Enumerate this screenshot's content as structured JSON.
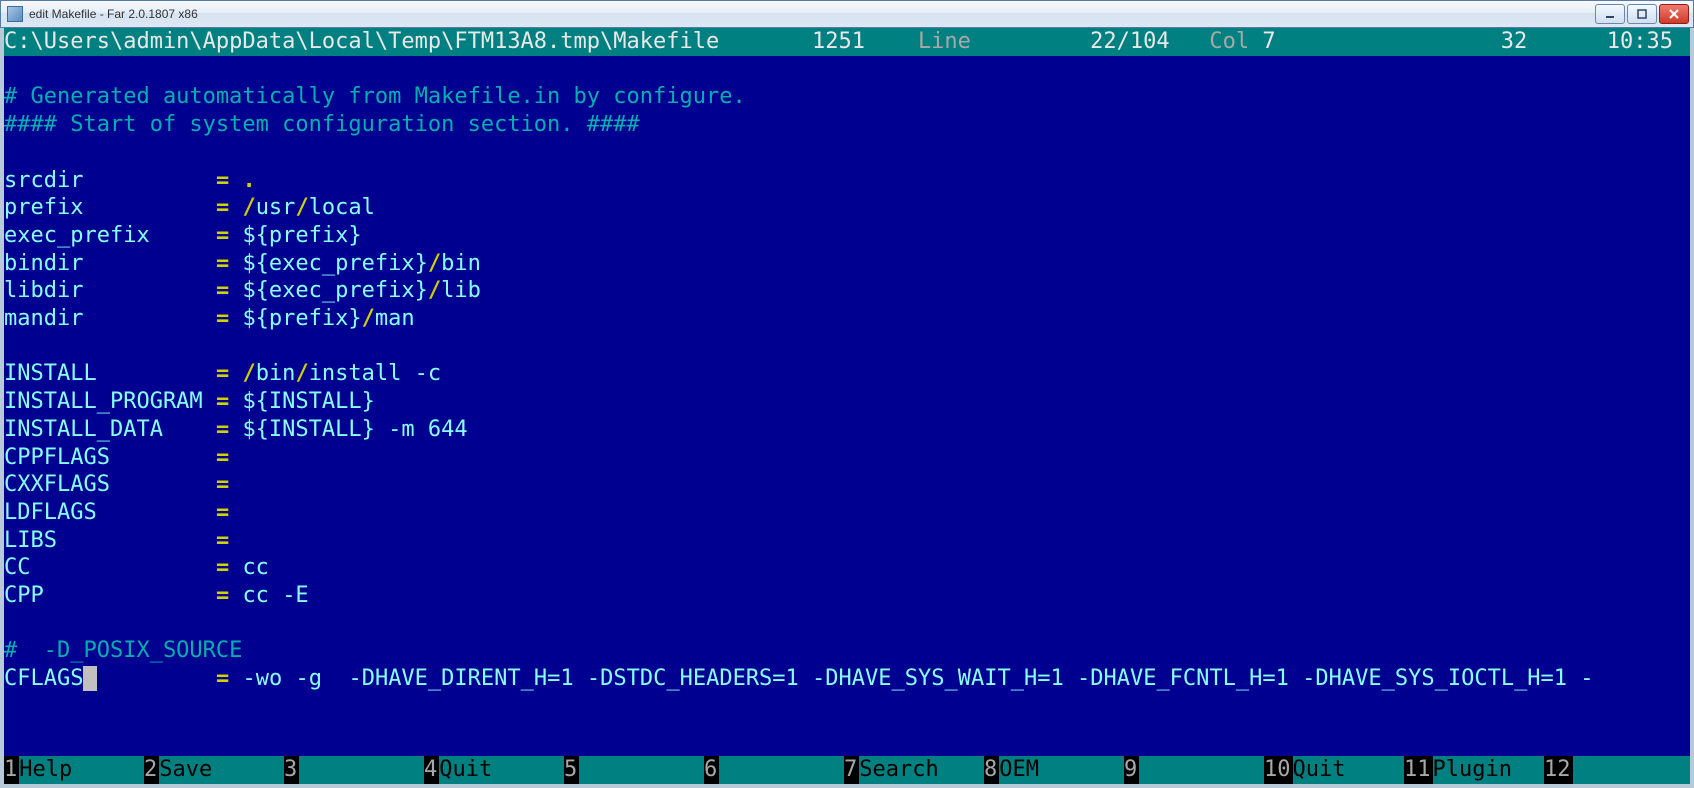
{
  "window": {
    "title": "edit Makefile - Far 2.0.1807 x86"
  },
  "status": {
    "path": "C:\\Users\\admin\\AppData\\Local\\Temp\\FTM13A8.tmp\\Makefile",
    "codepage": "1251",
    "line_label": "Line",
    "line_pos": "22/104",
    "col_label": "Col",
    "col_val": "7",
    "charcode": "32",
    "time": "10:35"
  },
  "content": {
    "l1": "# Generated automatically from Makefile.in by configure.",
    "l2": "#### Start of system configuration section. ####",
    "srcdir": "srcdir",
    "prefix": "prefix",
    "exec_prefix": "exec_prefix",
    "bindir": "bindir",
    "libdir": "libdir",
    "mandir": "mandir",
    "install": "INSTALL",
    "install_program": "INSTALL_PROGRAM",
    "install_data": "INSTALL_DATA",
    "cppflags": "CPPFLAGS",
    "cxxflags": "CXXFLAGS",
    "ldflags": "LDFLAGS",
    "libs": "LIBS",
    "cc": "CC",
    "cpp": "CPP",
    "posix_comment": "#  -D_POSIX_SOURCE",
    "cflags": "CFLAGS",
    "eq": "=",
    "dot": ".",
    "usr": "usr",
    "local": "local",
    "bin": "bin",
    "lib": "lib",
    "man": "man",
    "install_word": "install",
    "cc_word": "cc",
    "dash_c": "-c",
    "dash_E": "-E",
    "m644": "-m 644",
    "dollar_prefix": "${prefix}",
    "dollar_exec_prefix": "${exec_prefix}",
    "dollar_install": "${INSTALL}",
    "slash": "/",
    "wo": "-wo",
    "g": "-g",
    "f1": "-DHAVE_DIRENT_H=1",
    "f2": "-DSTDC_HEADERS=1",
    "f3": "-DHAVE_SYS_WAIT_H=1",
    "f4": "-DHAVE_FCNTL_H=1",
    "f5": "-DHAVE_SYS_IOCTL_H=1",
    "dash": "-"
  },
  "keybar": [
    {
      "n": "1",
      "label": "Help  "
    },
    {
      "n": "2",
      "label": "Save  "
    },
    {
      "n": "3",
      "label": "      "
    },
    {
      "n": "4",
      "label": "Quit  "
    },
    {
      "n": "5",
      "label": "      "
    },
    {
      "n": "6",
      "label": "      "
    },
    {
      "n": "7",
      "label": "Search"
    },
    {
      "n": "8",
      "label": "OEM   "
    },
    {
      "n": "9",
      "label": "      "
    },
    {
      "n": "10",
      "label": "Quit  "
    },
    {
      "n": "11",
      "label": "Plugin"
    },
    {
      "n": "12",
      "label": "      "
    }
  ]
}
